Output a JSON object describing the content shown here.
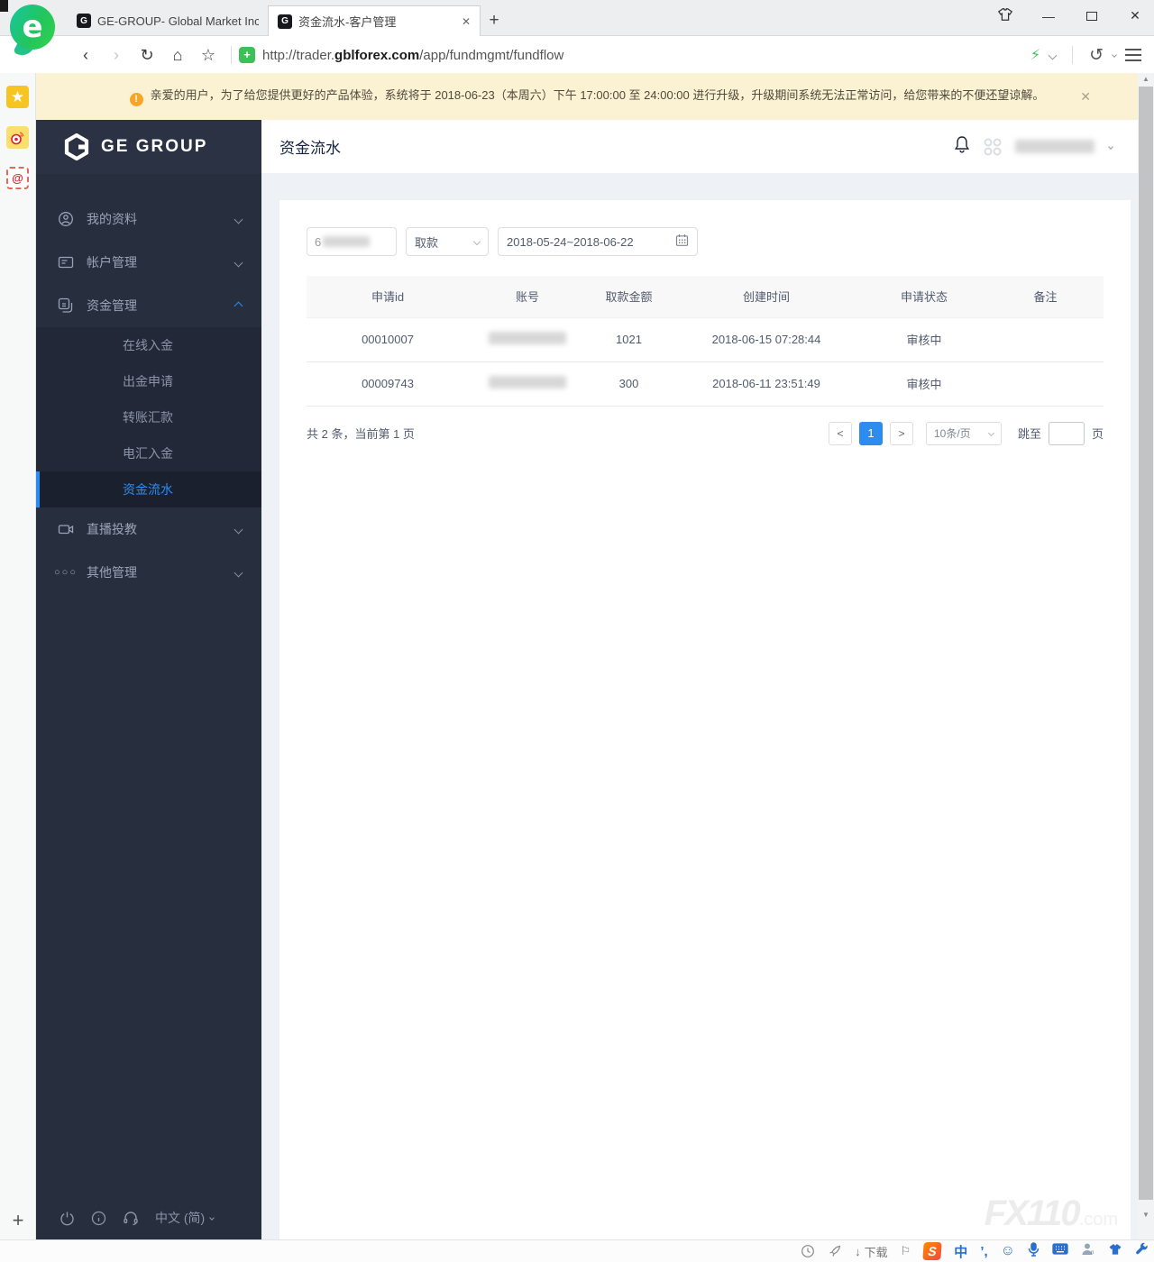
{
  "browser": {
    "tab1": {
      "title": "GE-GROUP- Global Market Inc"
    },
    "tab2": {
      "title": "资金流水-客户管理",
      "close": "✕"
    },
    "new_tab": "+",
    "nav": {
      "back": "‹",
      "forward": "›",
      "refresh": "↻",
      "home": "⌂",
      "favorite": "☆"
    },
    "url_prefix": "http://trader.",
    "url_domain": "gblforex.com",
    "url_path": "/app/fundmgmt/fundflow",
    "shield": "+",
    "bolt": "⚡",
    "undo": "↺",
    "window": {
      "minimize": "—",
      "close": "✕"
    }
  },
  "left_strip": {
    "star": "★",
    "mail": "@",
    "plus": "+"
  },
  "banner": {
    "icon": "!",
    "text": "亲爱的用户，为了给您提供更好的产品体验，系统将于 2018-06-23（本周六）下午 17:00:00 至 24:00:00 进行升级，升级期间系统无法正常访问，给您带来的不便还望谅解。",
    "close": "✕"
  },
  "sidebar": {
    "logo_text": "GE GROUP",
    "menu": [
      {
        "label": "我的资料"
      },
      {
        "label": "帐户管理"
      },
      {
        "label": "资金管理",
        "children": [
          "在线入金",
          "出金申请",
          "转账汇款",
          "电汇入金",
          "资金流水"
        ],
        "active_child": "资金流水"
      },
      {
        "label": "直播投教"
      },
      {
        "label": "其他管理"
      }
    ],
    "footer": {
      "language": "中文 (简)"
    }
  },
  "header": {
    "title": "资金流水"
  },
  "filters": {
    "account_visible_prefix": "6",
    "type_value": "取款",
    "date_value": "2018-05-24~2018-06-22"
  },
  "table": {
    "columns": [
      "申请id",
      "账号",
      "取款金额",
      "创建时间",
      "申请状态",
      "备注"
    ],
    "rows": [
      {
        "id": "00010007",
        "amount": "1021",
        "created": "2018-06-15 07:28:44",
        "status": "审核中",
        "note": ""
      },
      {
        "id": "00009743",
        "amount": "300",
        "created": "2018-06-11 23:51:49",
        "status": "审核中",
        "note": ""
      }
    ]
  },
  "pagination": {
    "summary": "共 2 条，当前第 1 页",
    "prev": "<",
    "page_1": "1",
    "next": ">",
    "page_size": "10条/页",
    "jump_label": "跳至",
    "page_unit": "页"
  },
  "watermark": {
    "main": "FX110",
    "suffix": ".com"
  },
  "statusbar": {
    "download": "下载",
    "flag": "⚐",
    "ime_lang": "中",
    "ime_punct": "’,",
    "smiley": "☺",
    "sogou": "S"
  },
  "colors": {
    "accent_blue": "#2d8cf0",
    "sidebar_dark": "#272e3d",
    "banner_bg": "#fbf1d3",
    "green": "#3fbf57"
  }
}
